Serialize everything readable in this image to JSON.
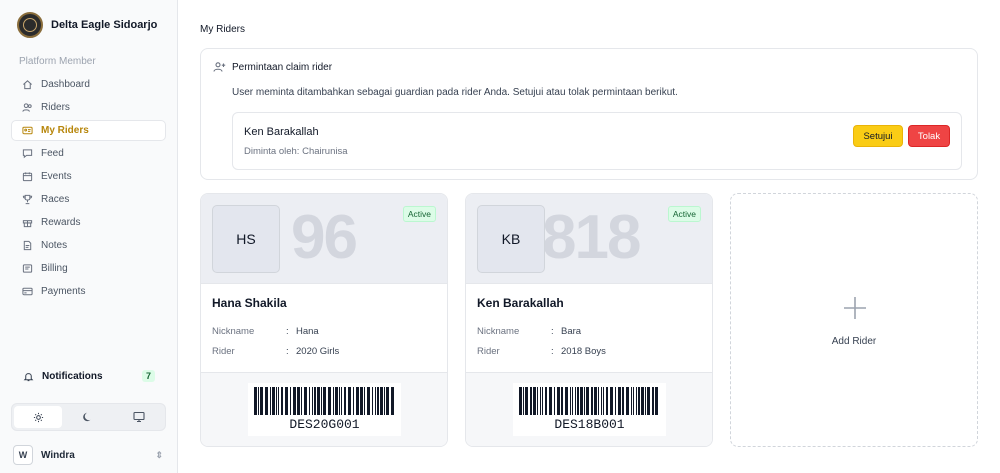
{
  "org": {
    "name": "Delta Eagle Sidoarjo"
  },
  "sidebar": {
    "section_label": "Platform Member",
    "items": [
      {
        "label": "Dashboard",
        "icon": "home-icon"
      },
      {
        "label": "Riders",
        "icon": "users-icon"
      },
      {
        "label": "My Riders",
        "icon": "id-card-icon",
        "active": true
      },
      {
        "label": "Feed",
        "icon": "chat-icon"
      },
      {
        "label": "Events",
        "icon": "calendar-icon"
      },
      {
        "label": "Races",
        "icon": "trophy-icon"
      },
      {
        "label": "Rewards",
        "icon": "gift-icon"
      },
      {
        "label": "Notes",
        "icon": "note-icon"
      },
      {
        "label": "Billing",
        "icon": "wallet-icon"
      },
      {
        "label": "Payments",
        "icon": "credit-card-icon"
      }
    ],
    "notifications": {
      "label": "Notifications",
      "count": "7"
    },
    "user": {
      "initial": "W",
      "name": "Windra"
    }
  },
  "main": {
    "title": "My Riders",
    "claim": {
      "title": "Permintaan claim rider",
      "description": "User meminta ditambahkan sebagai guardian pada rider Anda. Setujui atau tolak permintaan berikut.",
      "request": {
        "name": "Ken Barakallah",
        "requested_by": "Diminta oleh: Chairunisa",
        "approve_label": "Setujui",
        "reject_label": "Tolak"
      }
    },
    "riders": [
      {
        "initials": "HS",
        "number": "96",
        "status": "Active",
        "name": "Hana Shakila",
        "nickname_label": "Nickname",
        "nickname": "Hana",
        "rider_label": "Rider",
        "category": "2020 Girls",
        "code": "DES20G001"
      },
      {
        "initials": "KB",
        "number": "818",
        "status": "Active",
        "name": "Ken Barakallah",
        "nickname_label": "Nickname",
        "nickname": "Bara",
        "rider_label": "Rider",
        "category": "2018 Boys",
        "code": "DES18B001"
      }
    ],
    "add_rider_label": "Add Rider"
  },
  "colors": {
    "accent": "#b7860b",
    "approve": "#facc15",
    "reject": "#ef4444",
    "active_badge": "#dcfce7"
  }
}
